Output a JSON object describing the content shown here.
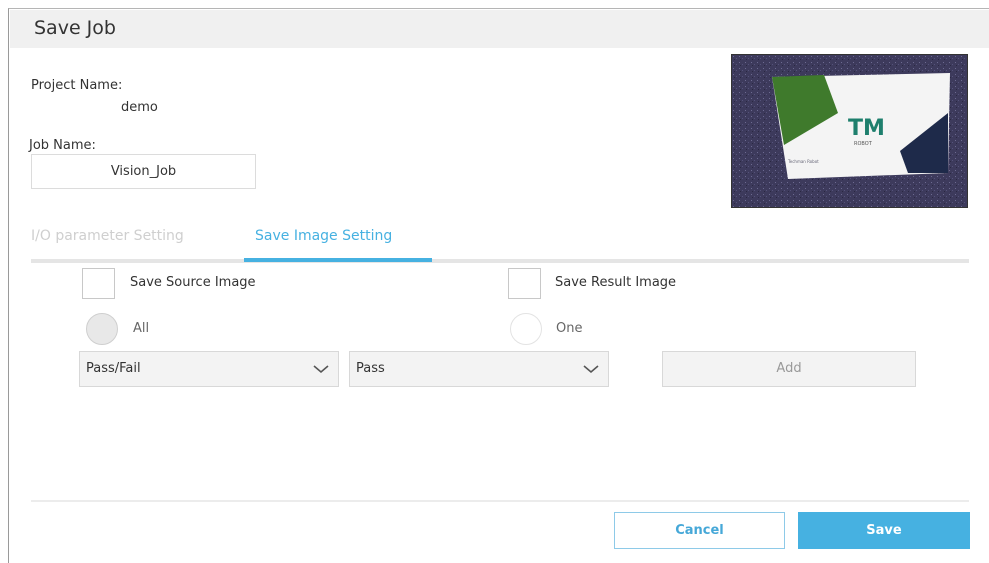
{
  "dialog": {
    "title": "Save Job"
  },
  "project": {
    "label": "Project Name:",
    "value": "demo"
  },
  "job": {
    "label": "Job Name:",
    "value": "Vision_Job"
  },
  "preview": {
    "logo_text": "TM",
    "logo_subtext": "ROBOT",
    "card_footer_text": "Techman Robot",
    "colors": {
      "green": "#3f7a2c",
      "navy": "#1e2a4a",
      "logo": "#1e7f6d"
    }
  },
  "tabs": [
    {
      "label": "I/O parameter Setting",
      "active": false
    },
    {
      "label": "Save Image Setting",
      "active": true
    }
  ],
  "options": {
    "save_source_label": "Save Source Image",
    "save_result_label": "Save Result Image",
    "radio_all_label": "All",
    "radio_one_label": "One"
  },
  "filters": {
    "condition_select": "Pass/Fail",
    "result_select": "Pass",
    "add_label": "Add"
  },
  "footer": {
    "cancel_label": "Cancel",
    "save_label": "Save"
  },
  "colors": {
    "accent": "#46b1e1",
    "tab_inactive": "#cfcfcf"
  }
}
